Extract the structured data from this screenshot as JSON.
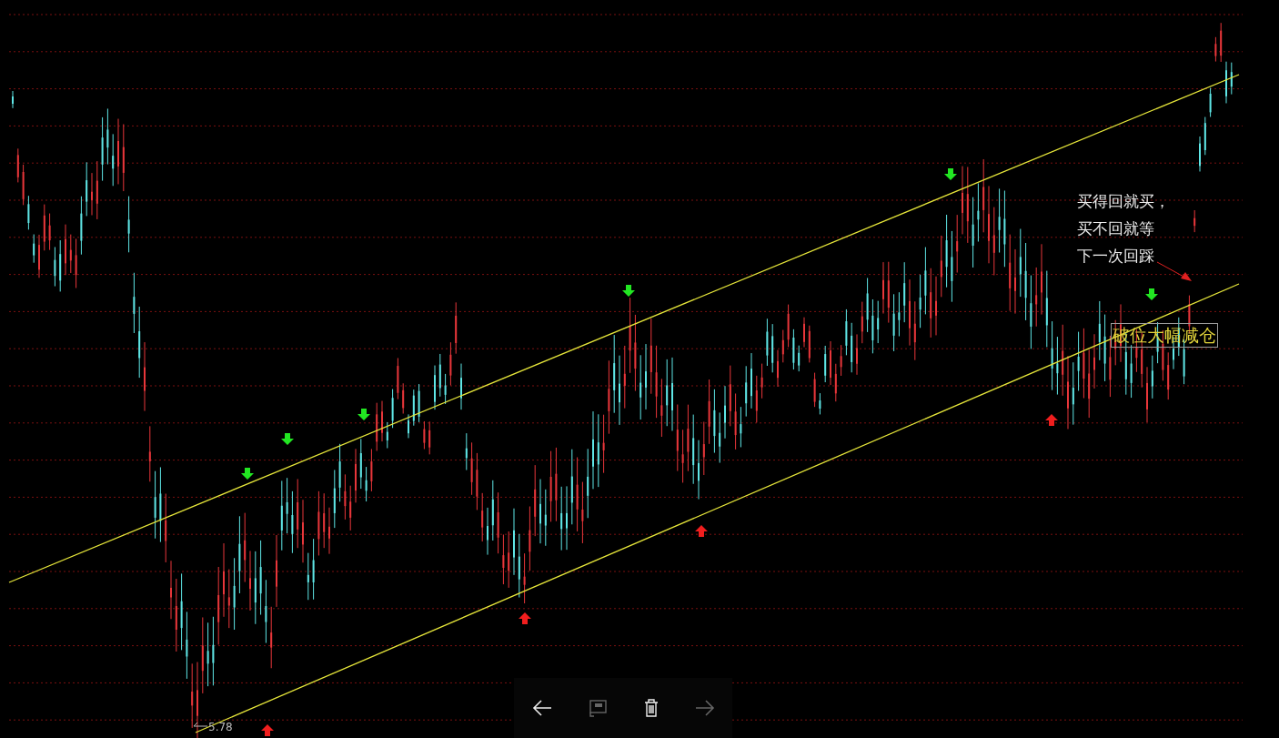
{
  "chart": {
    "note_lines": [
      "买得回就买，",
      "买不回就等",
      "下一次回踩"
    ],
    "signal_label": "破位大幅减仓",
    "low_marker": "5.78",
    "signals": [
      {
        "kind": "sell"
      },
      {
        "kind": "sell"
      },
      {
        "kind": "sell"
      },
      {
        "kind": "sell"
      },
      {
        "kind": "sell"
      },
      {
        "kind": "sell"
      },
      {
        "kind": "buy"
      },
      {
        "kind": "buy"
      },
      {
        "kind": "buy"
      },
      {
        "kind": "buy"
      }
    ]
  },
  "toolbar": [
    {
      "kind": "back",
      "disabled": false
    },
    {
      "kind": "comment",
      "disabled": true
    },
    {
      "kind": "delete",
      "disabled": false
    },
    {
      "kind": "forward",
      "disabled": true
    }
  ]
}
